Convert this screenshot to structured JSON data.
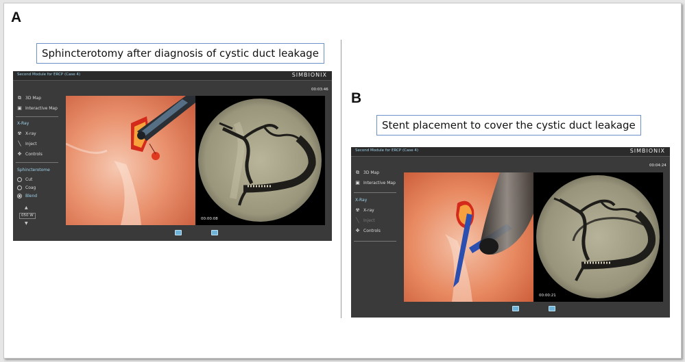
{
  "panels": [
    {
      "letter": "A",
      "caption": "Sphincterotomy after diagnosis of cystic duct leakage",
      "sim": {
        "window_title": "Second Module for ERCP (Case 4)",
        "brand": "SIMBIONIX",
        "session_time": "00:03:46",
        "video_time": "00:00:08",
        "menu": [
          {
            "label": "3D Map",
            "icon": "map-3d-icon"
          },
          {
            "label": "Interactive Map",
            "icon": "interactive-map-icon"
          }
        ],
        "xray_section": "X-Ray",
        "xray_items": [
          {
            "label": "X-ray",
            "icon": "xray-icon"
          },
          {
            "label": "Inject",
            "icon": "inject-icon"
          },
          {
            "label": "Controls",
            "icon": "controls-icon"
          }
        ],
        "sphincterotome_section": "Sphincterotome",
        "modes": [
          {
            "label": "Cut",
            "selected": false
          },
          {
            "label": "Coag",
            "selected": false
          },
          {
            "label": "Blend",
            "selected": true
          }
        ],
        "power": "050 W"
      }
    },
    {
      "letter": "B",
      "caption": "Stent placement to cover the cystic duct leakage",
      "sim": {
        "window_title": "Second Module for ERCP (Case 4)",
        "brand": "SIMBIONIX",
        "session_time": "00:04:24",
        "video_time": "00:00:21",
        "menu": [
          {
            "label": "3D Map",
            "icon": "map-3d-icon"
          },
          {
            "label": "Interactive Map",
            "icon": "interactive-map-icon"
          }
        ],
        "xray_section": "X-Ray",
        "xray_items": [
          {
            "label": "X-ray",
            "icon": "xray-icon",
            "disabled": false
          },
          {
            "label": "Inject",
            "icon": "inject-icon",
            "disabled": true
          },
          {
            "label": "Controls",
            "icon": "controls-icon",
            "disabled": false
          }
        ]
      }
    }
  ]
}
